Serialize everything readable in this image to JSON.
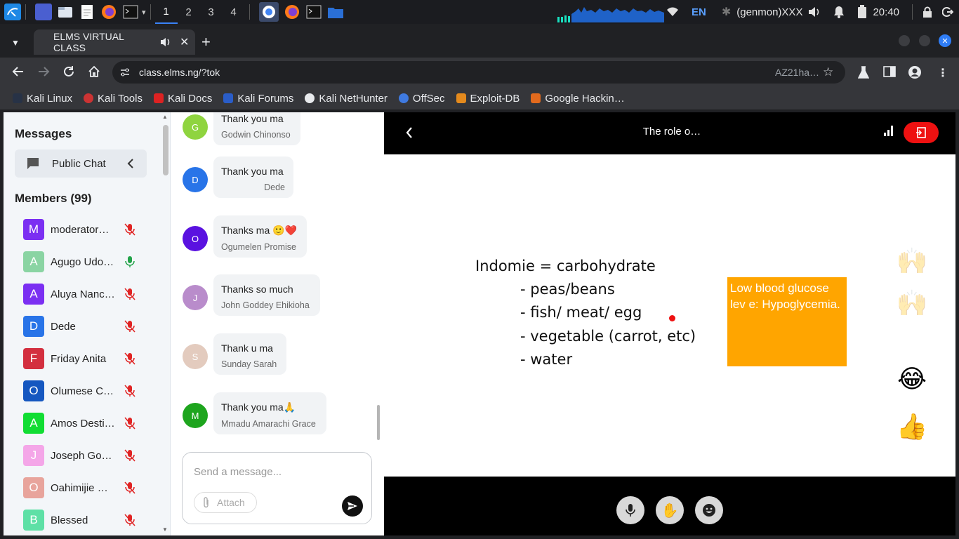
{
  "taskbar": {
    "workspaces": [
      "1",
      "2",
      "3",
      "4"
    ],
    "keyboard_layout": "EN",
    "genmon": "(genmon)XXX",
    "clock": "20:40"
  },
  "browser": {
    "tab_title": "ELMS VIRTUAL CLASS",
    "url": "class.elms.ng/?tok",
    "url_right": "AZ21ha…",
    "bookmarks": [
      "Kali Linux",
      "Kali Tools",
      "Kali Docs",
      "Kali Forums",
      "Kali NetHunter",
      "OffSec",
      "Exploit-DB",
      "Google Hackin…"
    ]
  },
  "sidebar": {
    "messages_heading": "Messages",
    "public_chat_label": "Public Chat",
    "members_heading": "Members (99)",
    "members": [
      {
        "initial": "M",
        "name": "moderator@…",
        "color": "#7b2ff2",
        "mic": "muted"
      },
      {
        "initial": "A",
        "name": "Agugo Udod…",
        "color": "#8ad4a3",
        "mic": "active"
      },
      {
        "initial": "A",
        "name": "Aluya Nanc…",
        "color": "#7b2ff2",
        "mic": "muted"
      },
      {
        "initial": "D",
        "name": "Dede",
        "color": "#2874e8",
        "mic": "muted"
      },
      {
        "initial": "F",
        "name": "Friday Anita",
        "color": "#d32f3f",
        "mic": "muted"
      },
      {
        "initial": "O",
        "name": "Olumese Ch…",
        "color": "#1557c0",
        "mic": "muted"
      },
      {
        "initial": "A",
        "name": "Amos Desti…",
        "color": "#11dd33",
        "mic": "muted"
      },
      {
        "initial": "J",
        "name": "Joseph God…",
        "color": "#f4a6e8",
        "mic": "muted"
      },
      {
        "initial": "O",
        "name": "Oahimijie M…",
        "color": "#e8a49c",
        "mic": "muted"
      },
      {
        "initial": "B",
        "name": "Blessed",
        "color": "#5ee0a6",
        "mic": "muted"
      }
    ]
  },
  "chat": {
    "messages": [
      {
        "initial": "G",
        "text": "Thank you ma",
        "sender": "Godwin Chinonso",
        "color": "#8fd43f"
      },
      {
        "initial": "D",
        "text": "Thank you ma",
        "sender": "Dede",
        "color": "#2874e8"
      },
      {
        "initial": "O",
        "text": "Thanks ma 🙂❤️",
        "sender": "Ogumelen Promise",
        "color": "#5a12e0"
      },
      {
        "initial": "J",
        "text": "Thanks so much",
        "sender": "John Goddey Ehikioha",
        "color": "#b98ccb"
      },
      {
        "initial": "S",
        "text": "Thank u ma",
        "sender": "Sunday Sarah",
        "color": "#e3cbbe"
      },
      {
        "initial": "M",
        "text": "Thank you ma🙏",
        "sender": "Mmadu Amarachi Grace",
        "color": "#1ea51e"
      }
    ],
    "input_placeholder": "Send a message...",
    "attach_label": "Attach"
  },
  "presentation": {
    "title": "The role o…",
    "whiteboard_lines": [
      "Indomie = carbohydrate",
      "- peas/beans",
      "- fish/ meat/ egg",
      "- vegetable (carrot, etc)",
      "- water"
    ],
    "sticky_note": "Low blood glucose lev e: Hypoglycemia.",
    "reactions": [
      "🙌",
      "🙌",
      "😂",
      "👍"
    ]
  },
  "colors": {
    "leave_button": "#ee1111",
    "sticky_note": "#ffa500",
    "accent": "#3a82f7"
  }
}
